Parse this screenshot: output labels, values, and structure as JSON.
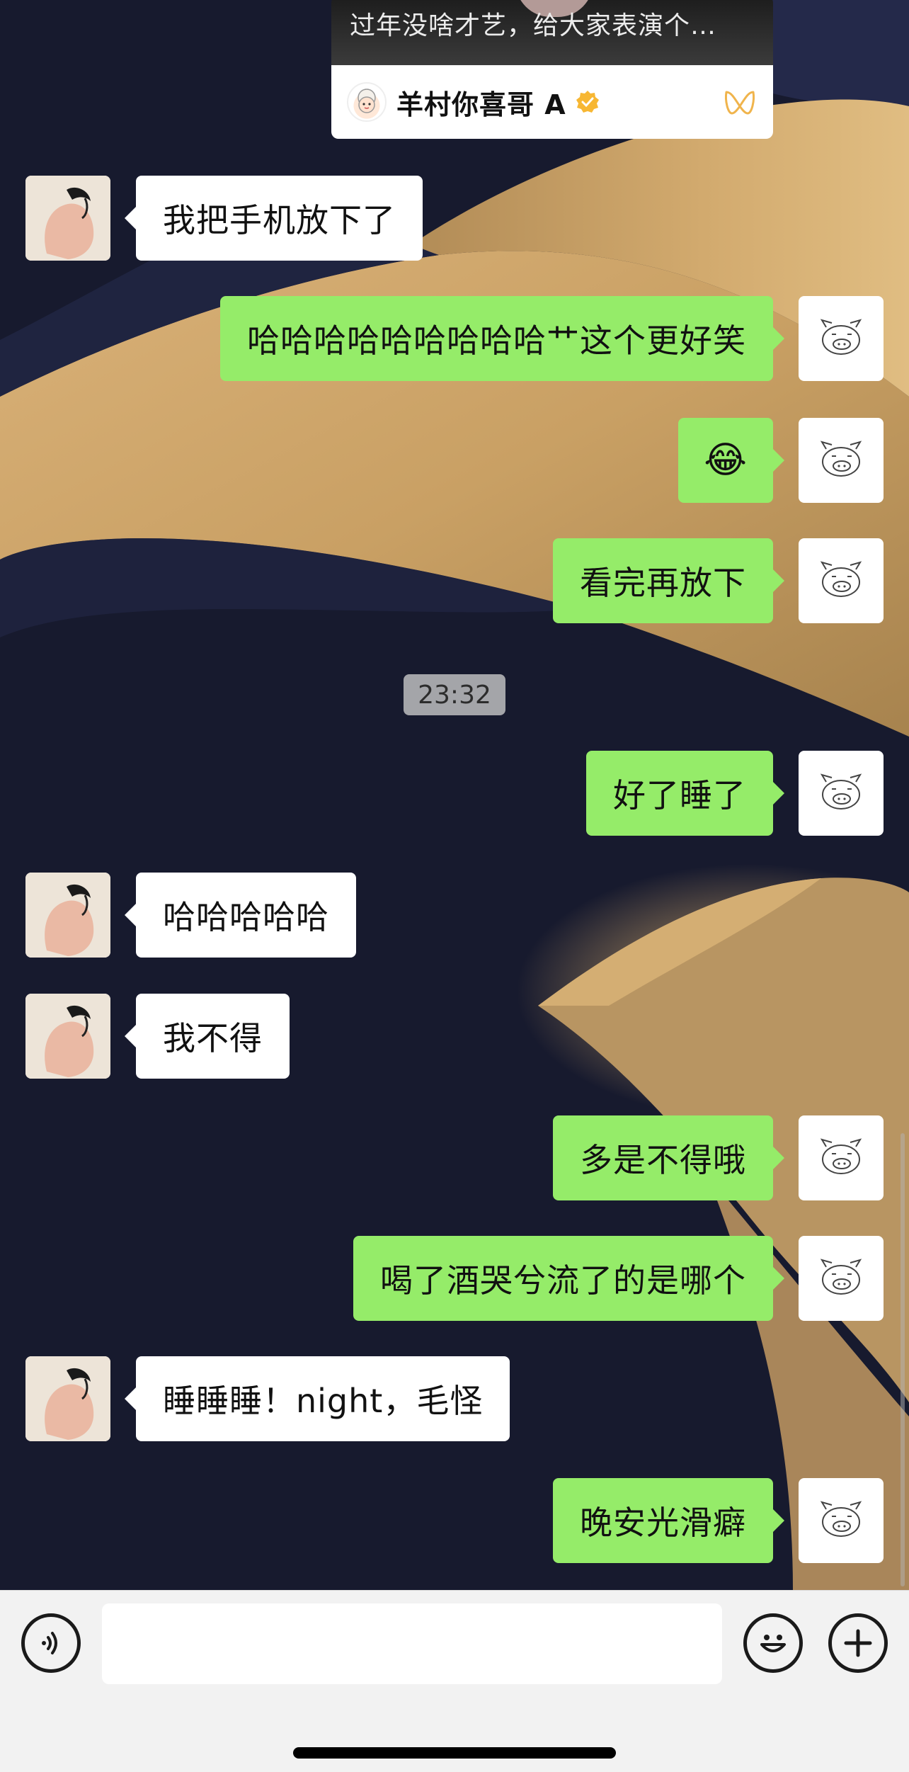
{
  "shared_card": {
    "video_title": "过年没啥才艺，给大家表演个…",
    "author": "羊村你喜哥 A"
  },
  "messages": [
    {
      "side": "left",
      "text": "我把手机放下了"
    },
    {
      "side": "right",
      "text": "哈哈哈哈哈哈哈哈哈艹这个更好笑"
    },
    {
      "side": "right",
      "text": "😂"
    },
    {
      "side": "right",
      "text": "看完再放下"
    },
    {
      "side": "right",
      "text": "好了睡了"
    },
    {
      "side": "left",
      "text": "哈哈哈哈哈"
    },
    {
      "side": "left",
      "text": "我不得"
    },
    {
      "side": "right",
      "text": "多是不得哦"
    },
    {
      "side": "right",
      "text": "喝了酒哭兮流了的是哪个"
    },
    {
      "side": "left",
      "text": "睡睡睡！night，毛怪"
    },
    {
      "side": "right",
      "text": "晚安光滑癖"
    }
  ],
  "timestamp": "23:32",
  "input_bar": {
    "voice_icon": "voice-icon",
    "emoji_icon": "emoji-icon",
    "plus_icon": "plus-icon",
    "placeholder": ""
  },
  "colors": {
    "sent_bubble": "#95ec69",
    "received_bubble": "#ffffff",
    "input_bar_bg": "#f2f2f2"
  }
}
